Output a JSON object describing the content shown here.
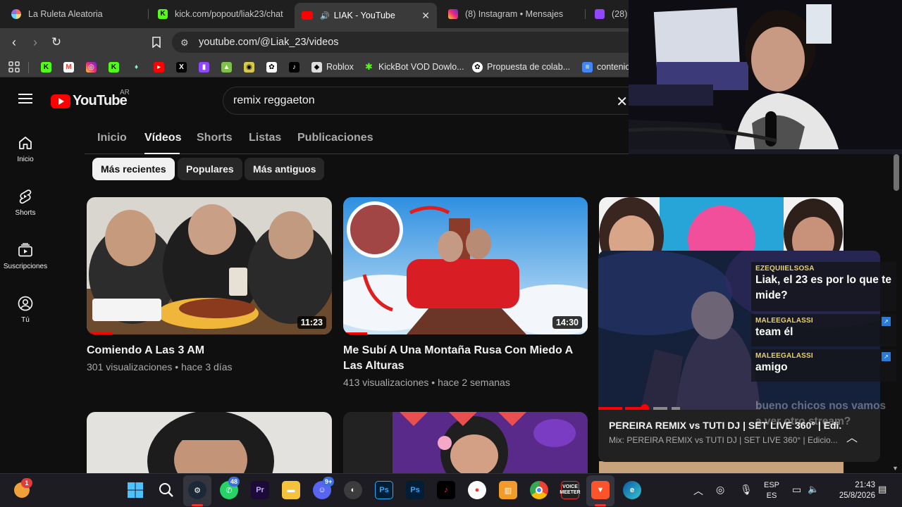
{
  "browser": {
    "tabs": [
      {
        "title": "La Ruleta Aleatoria",
        "color": "#9b6bd6"
      },
      {
        "title": "kick.com/popout/liak23/chat",
        "color": "#53fc18"
      },
      {
        "title": "LIAK - YouTube",
        "color": "#ff0000",
        "active": true
      },
      {
        "title": "(8) Instagram • Mensajes",
        "color": "#d6249f"
      },
      {
        "title": "(28)",
        "color": "#9146ff"
      }
    ],
    "url": "youtube.com/@Liak_23/videos",
    "bookmarks": [
      {
        "label": "Roblox",
        "icon": "roblox-icon"
      },
      {
        "label": "KickBot VOD Dowlo...",
        "icon": "kickbot-icon"
      },
      {
        "label": "Propuesta de colab...",
        "icon": "openai-icon"
      },
      {
        "label": "contenio",
        "icon": "docs-icon"
      }
    ]
  },
  "youtube": {
    "logo_text": "YouTube",
    "country_code": "AR",
    "search_value": "remix reggaeton",
    "sidebar": [
      {
        "label": "Inicio",
        "icon": "home-icon"
      },
      {
        "label": "Shorts",
        "icon": "shorts-icon"
      },
      {
        "label": "Suscripciones",
        "icon": "subscriptions-icon"
      },
      {
        "label": "Tú",
        "icon": "you-icon"
      }
    ],
    "channel_tabs": [
      "Inicio",
      "Vídeos",
      "Shorts",
      "Listas",
      "Publicaciones"
    ],
    "active_tab": "Vídeos",
    "chips": [
      "Más recientes",
      "Populares",
      "Más antiguos"
    ],
    "videos": [
      {
        "title": "Comiendo A Las 3 AM",
        "views": "301 visualizaciones",
        "age": "hace 3 días",
        "duration": "11:23"
      },
      {
        "title": "Me Subí A Una Montaña Rusa Con Miedo A Las Alturas",
        "views": "413 visualizaciones",
        "age": "hace 2 semanas",
        "duration": "14:30"
      }
    ]
  },
  "miniplayer": {
    "title": "PEREIRA REMIX vs TUTI DJ | SET LIVE 360° | Edi...",
    "subtitle": "Mix: PEREIRA REMIX vs TUTI DJ | SET LIVE 360° | Edicio..."
  },
  "chat": [
    {
      "user": "EZEQUIIELSOSA",
      "text": "Liak, el 23 es por lo que te mide?"
    },
    {
      "user": "MALEEGALASSI",
      "text": "team él"
    },
    {
      "user": "MALEEGALASSI",
      "text": "amigo"
    },
    {
      "user": "",
      "text": "bueno chicos nos vamos a ver otro stream?"
    }
  ],
  "taskbar": {
    "weather_badge": "1",
    "whatsapp_badge": "48",
    "discord_badge": "9+",
    "voicemeeter_label": "VOICE MEETER",
    "lang_top": "ESP",
    "lang_bottom": "ES",
    "time": "21:43",
    "date": "25/8/2026"
  }
}
